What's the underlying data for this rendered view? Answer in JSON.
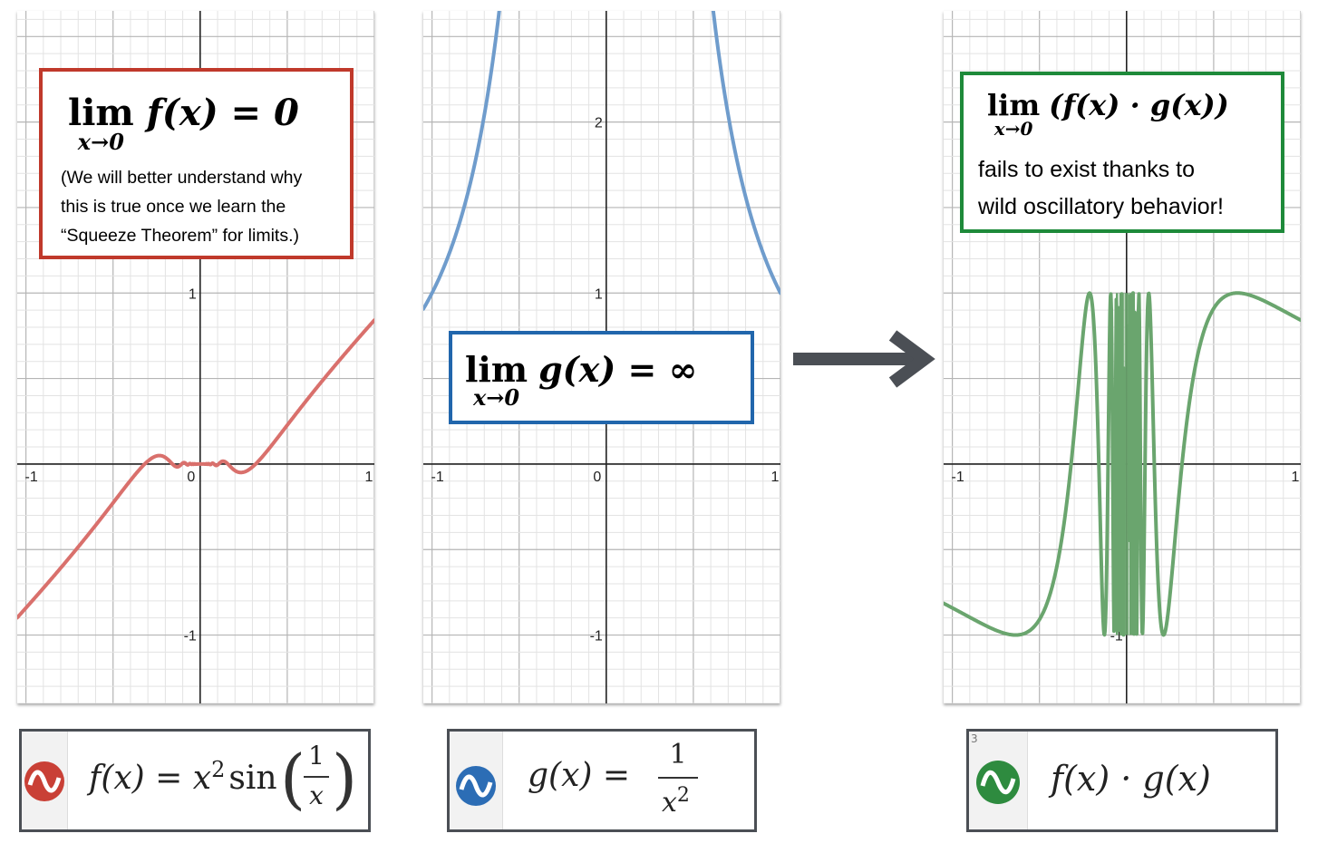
{
  "colors": {
    "red": "#d9706c",
    "blue": "#6f9ccc",
    "green": "#6aa56e",
    "box_red": "#c0392b",
    "box_blue": "#2166ac",
    "box_green": "#1e8a3a",
    "arrow": "#4b4f55"
  },
  "panels": [
    {
      "id": "f",
      "func": "x^2 sin(1/x)",
      "color": "#d9706c",
      "x_ticks": [
        "-1",
        "0",
        "1"
      ],
      "y_ticks": [
        "1",
        "-1"
      ],
      "xlim": [
        -1.05,
        1.0
      ],
      "ylim": [
        -1.4,
        2.65
      ]
    },
    {
      "id": "g",
      "func": "1/x^2",
      "color": "#6f9ccc",
      "x_ticks": [
        "-1",
        "0",
        "1"
      ],
      "y_ticks": [
        "2",
        "1",
        "-1"
      ],
      "xlim": [
        -1.05,
        1.0
      ],
      "ylim": [
        -1.4,
        2.65
      ]
    },
    {
      "id": "fg",
      "func": "sin(1/x)",
      "color": "#6aa56e",
      "x_ticks": [
        "-1",
        "0",
        "1"
      ],
      "y_ticks": [
        "-1"
      ],
      "xlim": [
        -1.05,
        1.0
      ],
      "ylim": [
        -1.4,
        2.65
      ]
    }
  ],
  "chart_data": [
    {
      "type": "line",
      "series": [
        {
          "function": "f(x) = x^2 sin(1/x)"
        }
      ],
      "xlim": [
        -1.05,
        1.0
      ],
      "ylim": [
        -1.4,
        2.65
      ],
      "grid": true
    },
    {
      "type": "line",
      "series": [
        {
          "function": "g(x) = 1/x^2"
        }
      ],
      "xlim": [
        -1.05,
        1.0
      ],
      "ylim": [
        -1.4,
        2.65
      ],
      "grid": true
    },
    {
      "type": "line",
      "series": [
        {
          "function": "f(x)·g(x)"
        }
      ],
      "xlim": [
        -1.05,
        1.0
      ],
      "ylim": [
        -1.4,
        2.65
      ],
      "grid": true
    }
  ],
  "box_f": {
    "lim": "lim",
    "sub": "x→0",
    "expr": "f(x) = 0",
    "note1": "(We will better understand why",
    "note2": "this is true once we learn the",
    "note3": "“Squeeze Theorem” for limits.)"
  },
  "box_g": {
    "lim": "lim",
    "sub": "x→0",
    "expr": "g(x) = ∞"
  },
  "box_fg": {
    "lim": "lim",
    "sub": "x→0",
    "expr": "(f(x) · g(x))",
    "note1": "fails to exist thanks to",
    "note2": "wild oscillatory behavior!"
  },
  "formulas": {
    "f": {
      "lhs": "f(x) = x",
      "exp": "2",
      "sin": "sin",
      "num": "1",
      "den": "x"
    },
    "g": {
      "lhs": "g(x) =",
      "num": "1",
      "den": "x",
      "exp": "2"
    },
    "fg": {
      "text": "f(x) · g(x)",
      "label": "3"
    }
  }
}
